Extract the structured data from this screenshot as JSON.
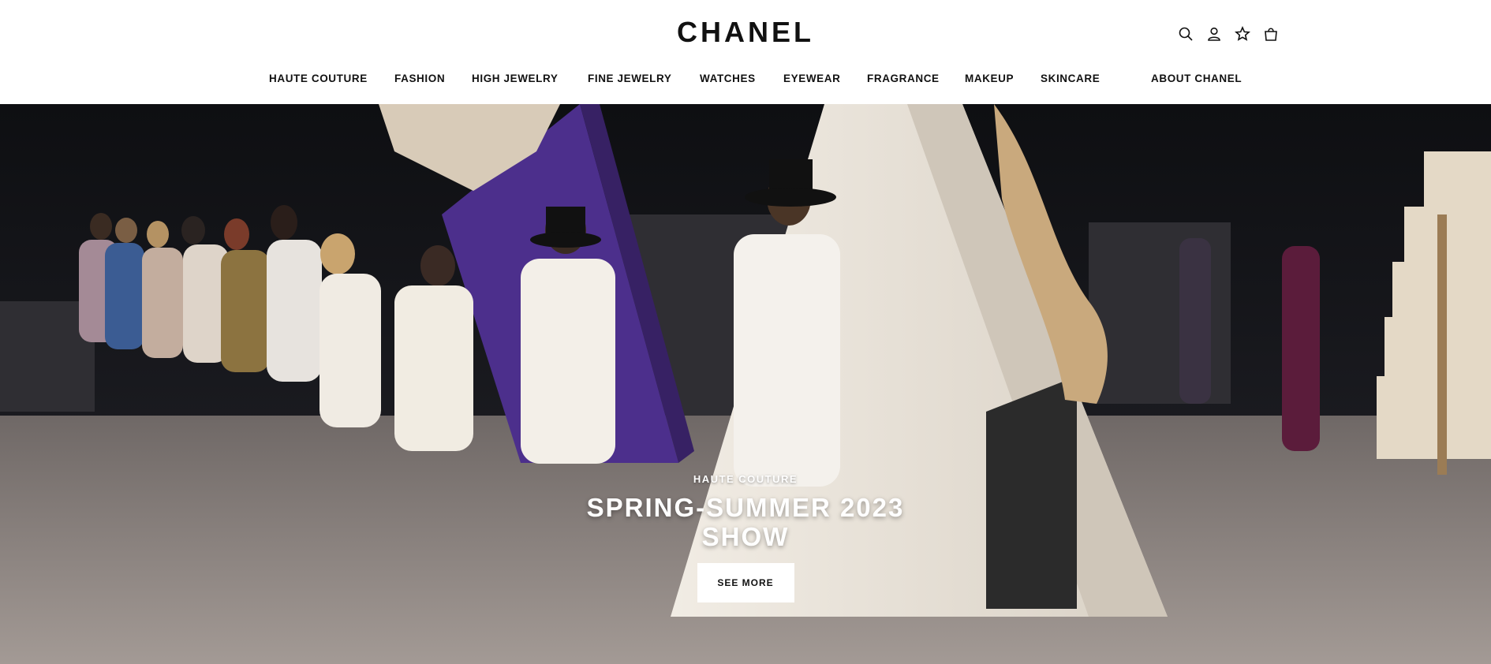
{
  "header": {
    "logo": "CHANEL",
    "icons": [
      "search-icon",
      "account-icon",
      "wishlist-star-icon",
      "shopping-bag-icon"
    ]
  },
  "nav": {
    "items": [
      {
        "label": "HAUTE COUTURE"
      },
      {
        "label": "FASHION"
      },
      {
        "label": "HIGH JEWELRY"
      },
      {
        "label": "FINE JEWELRY"
      },
      {
        "label": "WATCHES"
      },
      {
        "label": "EYEWEAR"
      },
      {
        "label": "FRAGRANCE"
      },
      {
        "label": "MAKEUP"
      },
      {
        "label": "SKINCARE"
      },
      {
        "label": "ABOUT CHANEL"
      }
    ]
  },
  "hero": {
    "eyebrow": "HAUTE COUTURE",
    "headline_line1": "SPRING-SUMMER 2023",
    "headline_line2": "SHOW",
    "cta_label": "SEE MORE"
  },
  "colors": {
    "text": "#111111",
    "background": "#ffffff",
    "hero_dark": "#1a1a1c",
    "floor": "#8f8783",
    "purple_prop": "#4c2f8c",
    "cream_prop": "#e9e3da"
  }
}
